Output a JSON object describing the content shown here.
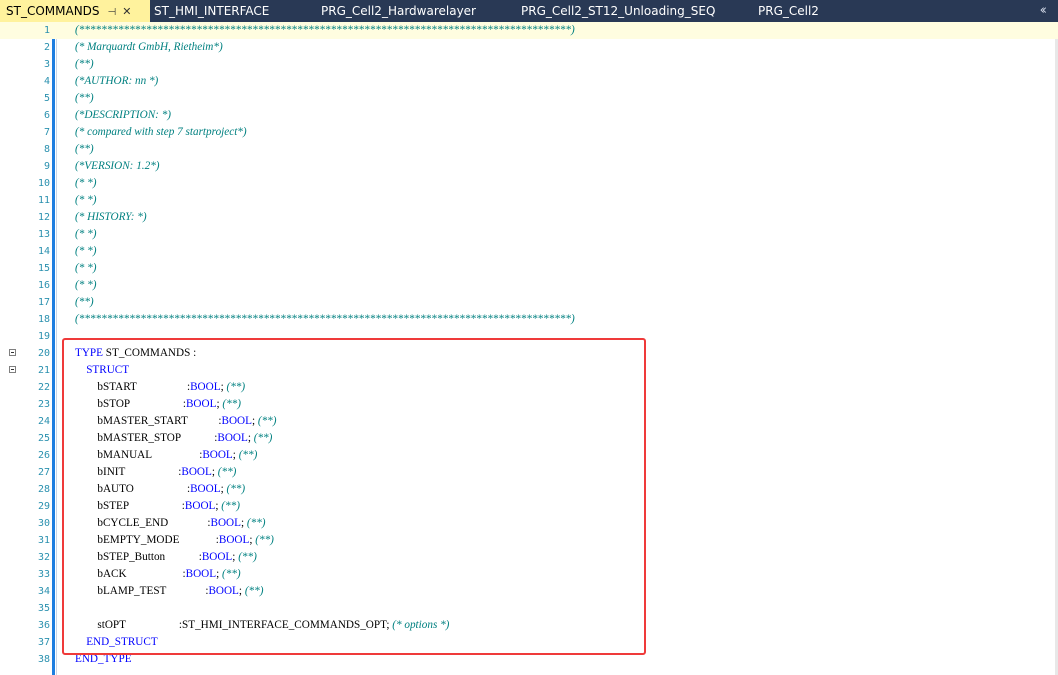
{
  "tabs": [
    {
      "label": "ST_COMMANDS",
      "active": true
    },
    {
      "label": "ST_HMI_INTERFACE"
    },
    {
      "label": "PRG_Cell2_Hardwarelayer"
    },
    {
      "label": "PRG_Cell2_ST12_Unloading_SEQ"
    },
    {
      "label": "PRG_Cell2"
    }
  ],
  "tab_pin_icon": "pin-icon",
  "tab_close_icon": "close-icon",
  "tab_overflow_icon": "double-chevron-left-icon",
  "colors": {
    "tabbar_bg": "#293955",
    "active_tab_bg": "#fff29d",
    "keyword": "#0000ff",
    "comment": "#008080",
    "line_number": "#2b91af",
    "highlight_box": "#ef3a3a"
  },
  "lines": [
    {
      "n": "1",
      "cm": "(****************************************************************************************)"
    },
    {
      "n": "2",
      "cm": "(* Marquardt GmbH, Rietheim*)"
    },
    {
      "n": "3",
      "cm": "(**)"
    },
    {
      "n": "4",
      "cm": "(*AUTHOR: nn *)"
    },
    {
      "n": "5",
      "cm": "(**)"
    },
    {
      "n": "6",
      "cm": "(*DESCRIPTION: *)"
    },
    {
      "n": "7",
      "cm": "(* compared with step 7 startproject*)"
    },
    {
      "n": "8",
      "cm": "(**)"
    },
    {
      "n": "9",
      "cm": "(*VERSION: 1.2*)"
    },
    {
      "n": "10",
      "cm": "(* *)"
    },
    {
      "n": "11",
      "cm": "(* *)"
    },
    {
      "n": "12",
      "cm": "(* HISTORY: *)"
    },
    {
      "n": "13",
      "cm": "(* *)"
    },
    {
      "n": "14",
      "cm": "(* *)"
    },
    {
      "n": "15",
      "cm": "(* *)"
    },
    {
      "n": "16",
      "cm": "(* *)"
    },
    {
      "n": "17",
      "cm": "(**)"
    },
    {
      "n": "18",
      "cm": "(****************************************************************************************)"
    },
    {
      "n": "19"
    },
    {
      "n": "20",
      "kw": "TYPE",
      "pl": " ST_COMMANDS :",
      "fold": true
    },
    {
      "n": "21",
      "kw": "    STRUCT",
      "fold": true
    },
    {
      "n": "22",
      "pl": "        bSTART                  :",
      "ty": "BOOL",
      "pl2": "; ",
      "cm": "(**)"
    },
    {
      "n": "23",
      "pl": "        bSTOP                   :",
      "ty": "BOOL",
      "pl2": "; ",
      "cm": "(**)"
    },
    {
      "n": "24",
      "pl": "        bMASTER_START           :",
      "ty": "BOOL",
      "pl2": "; ",
      "cm": "(**)"
    },
    {
      "n": "25",
      "pl": "        bMASTER_STOP            :",
      "ty": "BOOL",
      "pl2": "; ",
      "cm": "(**)"
    },
    {
      "n": "26",
      "pl": "        bMANUAL                 :",
      "ty": "BOOL",
      "pl2": "; ",
      "cm": "(**)"
    },
    {
      "n": "27",
      "pl": "        bINIT                   :",
      "ty": "BOOL",
      "pl2": "; ",
      "cm": "(**)"
    },
    {
      "n": "28",
      "pl": "        bAUTO                   :",
      "ty": "BOOL",
      "pl2": "; ",
      "cm": "(**)"
    },
    {
      "n": "29",
      "pl": "        bSTEP                   :",
      "ty": "BOOL",
      "pl2": "; ",
      "cm": "(**)"
    },
    {
      "n": "30",
      "pl": "        bCYCLE_END              :",
      "ty": "BOOL",
      "pl2": "; ",
      "cm": "(**)"
    },
    {
      "n": "31",
      "pl": "        bEMPTY_MODE             :",
      "ty": "BOOL",
      "pl2": "; ",
      "cm": "(**)"
    },
    {
      "n": "32",
      "pl": "        bSTEP_Button            :",
      "ty": "BOOL",
      "pl2": "; ",
      "cm": "(**)"
    },
    {
      "n": "33",
      "pl": "        bACK                    :",
      "ty": "BOOL",
      "pl2": "; ",
      "cm": "(**)"
    },
    {
      "n": "34",
      "pl": "        bLAMP_TEST              :",
      "ty": "BOOL",
      "pl2": "; ",
      "cm": "(**)"
    },
    {
      "n": "35"
    },
    {
      "n": "36",
      "pl": "        stOPT                   :ST_HMI_INTERFACE_COMMANDS_OPT; ",
      "cm": "(* options *)"
    },
    {
      "n": "37",
      "kw": "    END_STRUCT"
    },
    {
      "n": "38",
      "kw": "END_TYPE"
    }
  ]
}
